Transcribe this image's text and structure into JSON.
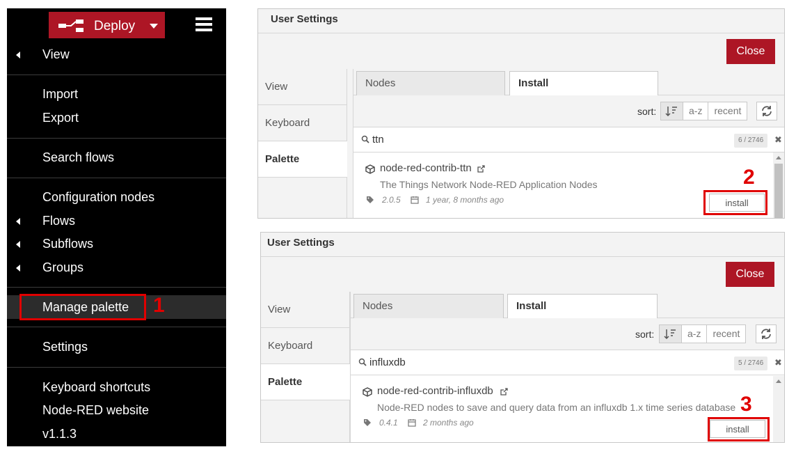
{
  "menu": {
    "deploy_label": "Deploy",
    "items": {
      "view": "View",
      "import": "Import",
      "export": "Export",
      "search_flows": "Search flows",
      "configuration_nodes": "Configuration nodes",
      "flows": "Flows",
      "subflows": "Subflows",
      "groups": "Groups",
      "manage_palette": "Manage palette",
      "settings": "Settings",
      "keyboard_shortcuts": "Keyboard shortcuts",
      "node_red_website": "Node-RED website",
      "version": "v1.1.3"
    }
  },
  "steps": {
    "one": "1",
    "two": "2",
    "three": "3"
  },
  "dialog_top": {
    "title": "User Settings",
    "close_label": "Close",
    "sidebar": [
      "View",
      "Keyboard",
      "Palette"
    ],
    "tabs": [
      "Nodes",
      "Install"
    ],
    "sort_label": "sort:",
    "sort_options": [
      "a-z",
      "recent"
    ],
    "search_value": "ttn",
    "count": "6 / 2746",
    "clear": "✖",
    "package": {
      "name": "node-red-contrib-ttn",
      "description": "The Things Network Node-RED Application Nodes",
      "version": "2.0.5",
      "updated": "1 year, 8 months ago",
      "install_label": "install"
    }
  },
  "dialog_bottom": {
    "title": "User Settings",
    "close_label": "Close",
    "sidebar": [
      "View",
      "Keyboard",
      "Palette"
    ],
    "tabs": [
      "Nodes",
      "Install"
    ],
    "sort_label": "sort:",
    "sort_options": [
      "a-z",
      "recent"
    ],
    "search_value": "influxdb",
    "count": "5 / 2746",
    "clear": "✖",
    "package": {
      "name": "node-red-contrib-influxdb",
      "description": "Node-RED nodes to save and query data from an influxdb 1.x time series database",
      "version": "0.4.1",
      "updated": "2 months ago",
      "install_label": "install"
    }
  },
  "colors": {
    "accent_red": "#ad1625",
    "highlight_red": "#e00000",
    "menu_bg": "#000000",
    "panel_bg": "#f3f3f3"
  },
  "icons": [
    "flow-icon",
    "hamburger-icon",
    "caret-down-icon",
    "chevron-left-icon",
    "search-icon",
    "package-icon",
    "external-link-icon",
    "tag-icon",
    "calendar-icon",
    "sort-icon",
    "refresh-icon",
    "close-icon"
  ]
}
